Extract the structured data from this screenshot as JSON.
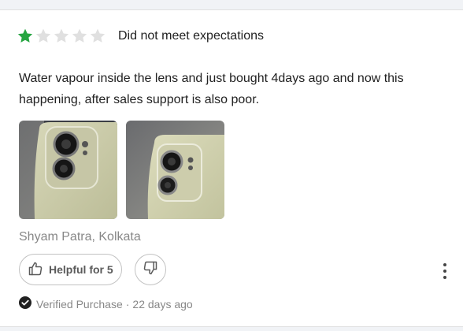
{
  "review": {
    "rating": 1,
    "max_rating": 5,
    "star_filled_color": "#26a541",
    "star_empty_color": "#e0e0e0",
    "title": "Did not meet expectations",
    "body": "Water vapour inside the lens and just bought 4days ago and now this happening,  after sales support is also poor.",
    "reviewer": "Shyam Patra, Kolkata",
    "helpful_label": "Helpful for 5",
    "verified_label": "Verified Purchase",
    "separator": "·",
    "age": "22 days ago"
  },
  "icons": {
    "star": "star-icon",
    "thumbs_up": "thumbs-up-icon",
    "thumbs_down": "thumbs-down-icon",
    "more": "more-vertical-icon",
    "verified": "check-circle-icon"
  }
}
